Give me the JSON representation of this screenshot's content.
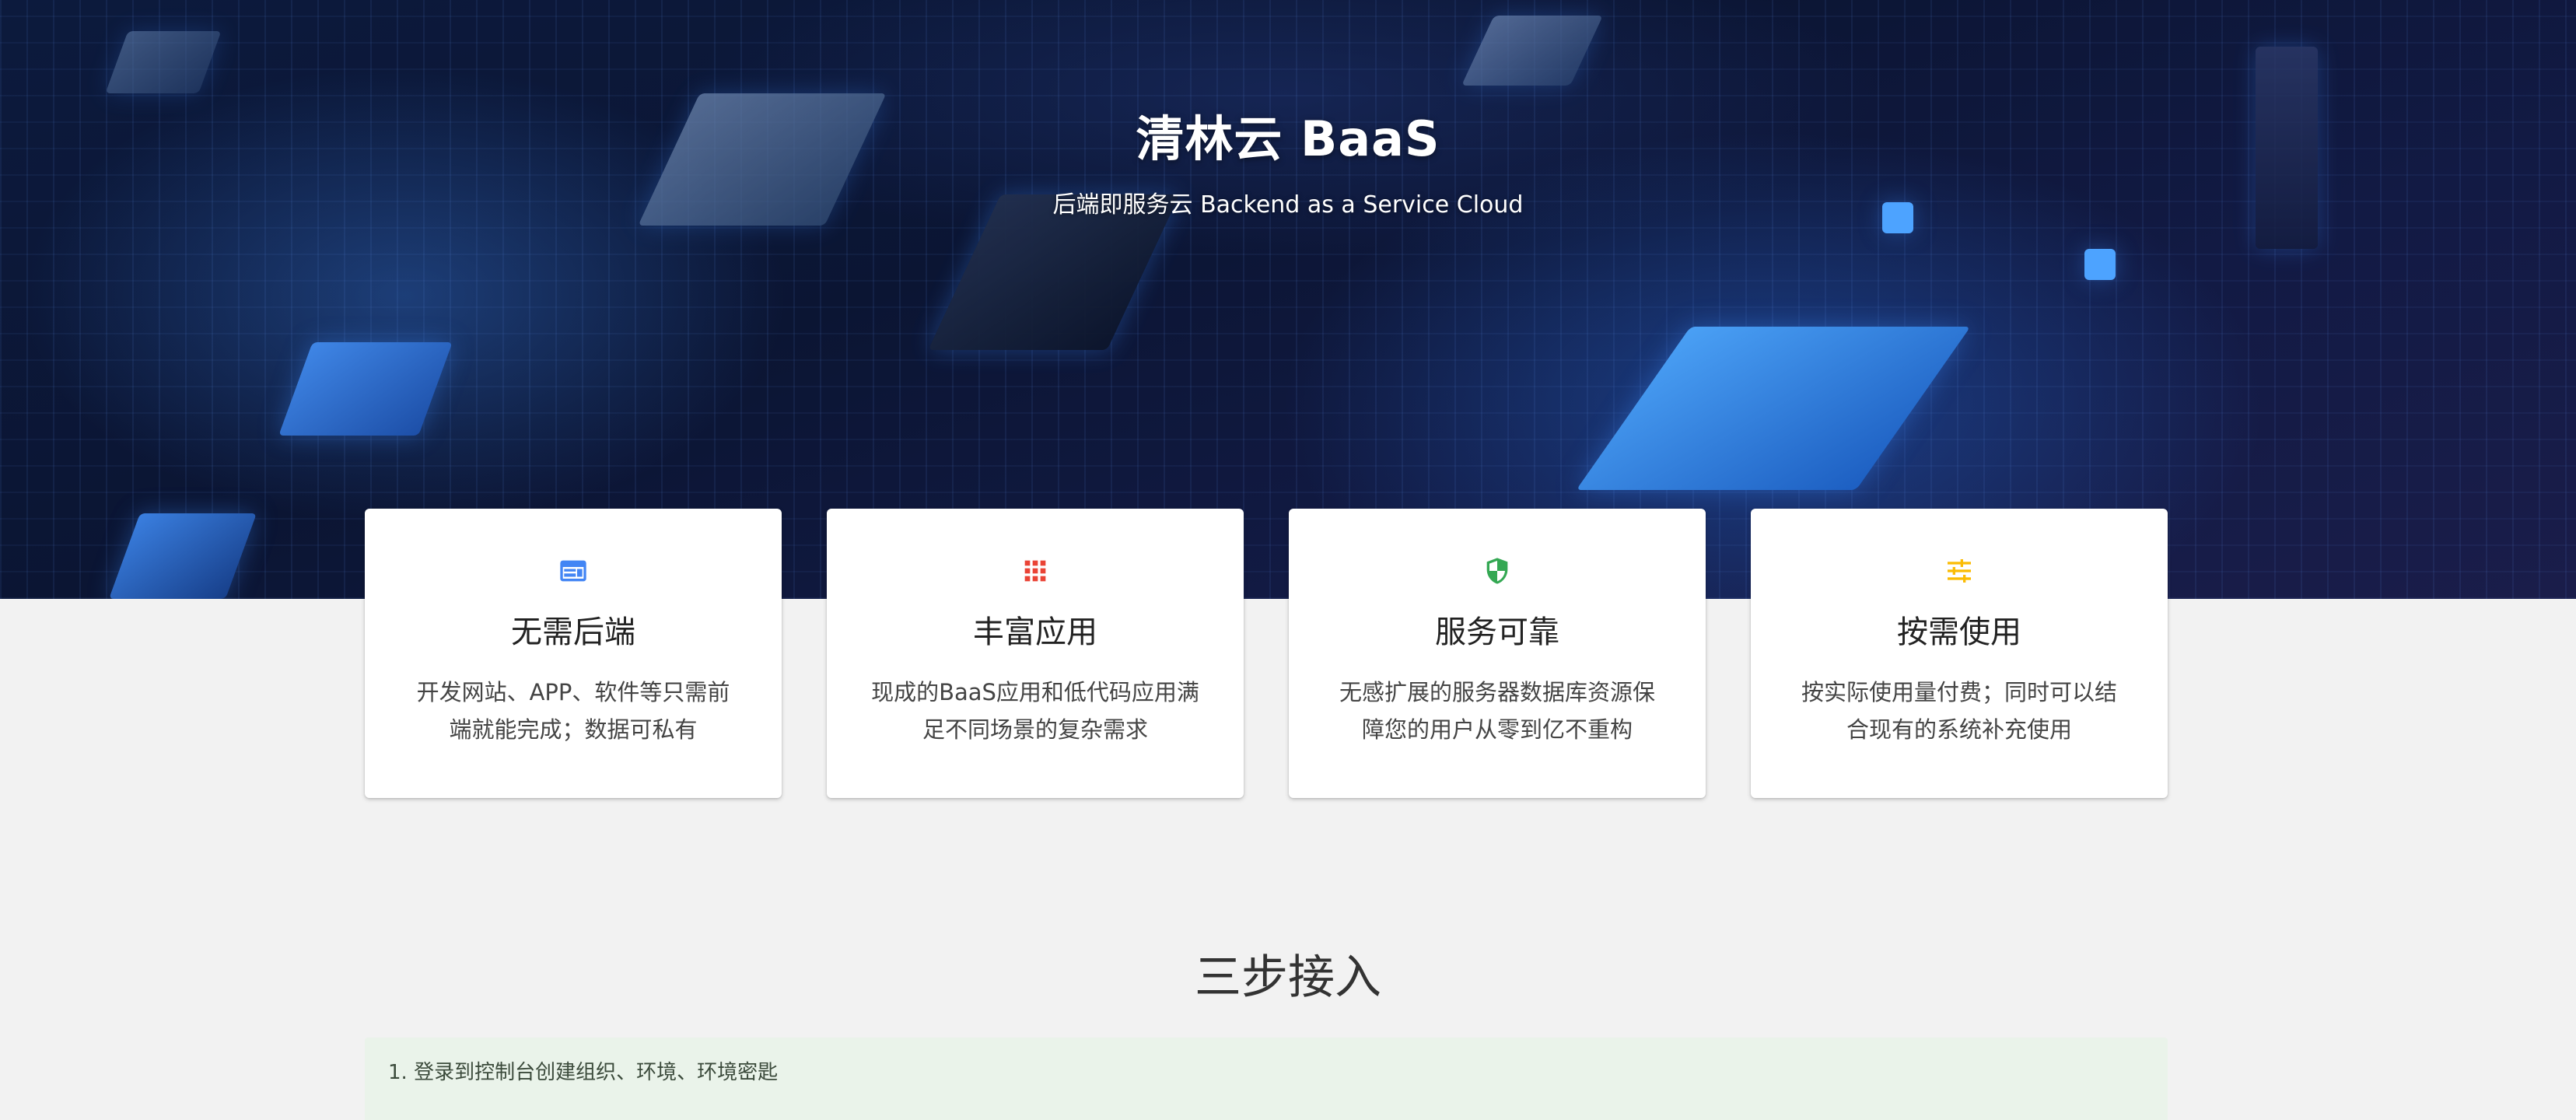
{
  "hero": {
    "title": "清林云 BaaS",
    "subtitle": "后端即服务云 Backend as a Service Cloud"
  },
  "features": [
    {
      "icon": "browser-window-icon",
      "icon_color": "#4285f4",
      "title": "无需后端",
      "desc": "开发网站、APP、软件等只需前端就能完成；数据可私有"
    },
    {
      "icon": "apps-grid-icon",
      "icon_color": "#ea4335",
      "title": "丰富应用",
      "desc": "现成的BaaS应用和低代码应用满足不同场景的复杂需求"
    },
    {
      "icon": "shield-icon",
      "icon_color": "#34a853",
      "title": "服务可靠",
      "desc": "无感扩展的服务器数据库资源保障您的用户从零到亿不重构"
    },
    {
      "icon": "tune-sliders-icon",
      "icon_color": "#fbbc05",
      "title": "按需使用",
      "desc": "按实际使用量付费；同时可以结合现有的系统补充使用"
    }
  ],
  "steps": {
    "heading": "三步接入",
    "items": [
      "1. 登录到控制台创建组织、环境、环境密匙"
    ]
  }
}
